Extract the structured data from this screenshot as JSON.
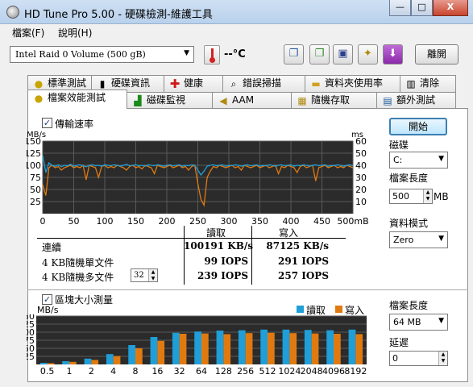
{
  "window": {
    "title": "HD Tune Pro  5.00 - 硬碟檢測-維護工具",
    "controls": {
      "minimize": "—",
      "maximize": "□",
      "close": "X"
    }
  },
  "menu": {
    "file": "檔案(F)",
    "help": "說明(H)"
  },
  "toolbar": {
    "drive": "Intel  Raid 0 Volume (500 gB)",
    "temperature": "--°C",
    "exit_label": "離開",
    "icons": [
      "copy-text-icon",
      "copy-screenshot-icon",
      "save-icon",
      "options-icon",
      "download-icon"
    ]
  },
  "tabs_top": [
    {
      "label": "標準測試",
      "icon": "benchmark-icon"
    },
    {
      "label": "硬碟資訊",
      "icon": "info-icon"
    },
    {
      "label": "健康",
      "icon": "health-icon"
    },
    {
      "label": "錯誤掃描",
      "icon": "error-scan-icon"
    },
    {
      "label": "資料夾使用率",
      "icon": "folder-icon"
    },
    {
      "label": "清除",
      "icon": "erase-icon"
    }
  ],
  "tabs_bottom": [
    {
      "label": "檔案效能測試",
      "icon": "file-benchmark-icon"
    },
    {
      "label": "磁碟監視",
      "icon": "disk-monitor-icon"
    },
    {
      "label": "AAM",
      "icon": "aam-speaker-icon"
    },
    {
      "label": "隨機存取",
      "icon": "random-access-icon"
    },
    {
      "label": "額外測試",
      "icon": "extra-tests-icon"
    }
  ],
  "transfer": {
    "checkbox_label": "傳輸速率",
    "checked": true,
    "left_unit": "MB/s",
    "right_unit": "ms"
  },
  "right_panel": {
    "start": "開始",
    "disk_label": "磁碟",
    "disk_value": "C:",
    "file_length_label": "檔案長度",
    "file_length_value": "500",
    "file_length_unit": "MB",
    "data_mode_label": "資料模式",
    "data_mode_value": "Zero",
    "block_file_length_label": "檔案長度",
    "block_file_length_value": "64 MB",
    "delay_label": "延遲",
    "delay_value": "0"
  },
  "results": {
    "read_header": "讀取",
    "write_header": "寫入",
    "rows": [
      {
        "label": "連續",
        "read": "100191 KB/s",
        "write": "87125 KB/s"
      },
      {
        "label": "4 KB隨機單文件",
        "read": "99 IOPS",
        "write": "291 IOPS"
      },
      {
        "label": "4 KB隨機多文件",
        "read": "239 IOPS",
        "write": "257 IOPS",
        "queue": "32"
      }
    ]
  },
  "block": {
    "checkbox_label": "區塊大小測量",
    "checked": true,
    "unit": "MB/s"
  },
  "colors": {
    "read": "#1f9ed8",
    "write": "#e07a10",
    "chart_bg": "#2b2b2b",
    "grid": "#5a5a5a"
  },
  "chart_data": [
    {
      "type": "line",
      "title": "",
      "xlabel": "",
      "ylabel": "MB/s",
      "y2label": "ms",
      "x_ticks": [
        "0",
        "50",
        "100",
        "150",
        "200",
        "250",
        "300",
        "350",
        "400",
        "450",
        "500mB"
      ],
      "y_ticks": [
        25,
        50,
        75,
        100,
        125,
        150
      ],
      "y2_ticks": [
        10,
        20,
        30,
        40,
        50,
        60
      ],
      "xlim": [
        0,
        500
      ],
      "ylim": [
        0,
        150
      ],
      "y2lim": [
        0,
        60
      ],
      "grid": true,
      "series": [
        {
          "name": "",
          "axis": "ms",
          "color": "#e07a10",
          "x": [
            0,
            5,
            10,
            15,
            20,
            25,
            30,
            35,
            40,
            45,
            50,
            55,
            60,
            65,
            70,
            75,
            80,
            85,
            90,
            95,
            100,
            105,
            110,
            115,
            120,
            125,
            130,
            135,
            140,
            145,
            150,
            155,
            160,
            165,
            170,
            175,
            180,
            185,
            190,
            195,
            200,
            205,
            210,
            215,
            220,
            225,
            230,
            235,
            240,
            245,
            250,
            255,
            260,
            265,
            270,
            275,
            280,
            285,
            290,
            295,
            300,
            305,
            310,
            315,
            320,
            325,
            330,
            335,
            340,
            345,
            350,
            355,
            360,
            365,
            370,
            375,
            380,
            385,
            390,
            395,
            400,
            405,
            410,
            415,
            420,
            425,
            430,
            435,
            440,
            445,
            450,
            455,
            460,
            465,
            470,
            475,
            480,
            485,
            490,
            495,
            500
          ],
          "y": [
            24,
            15,
            38,
            40,
            38,
            39,
            36,
            38,
            39,
            40,
            38,
            39,
            38,
            40,
            28,
            40,
            39,
            38,
            30,
            39,
            40,
            38,
            39,
            38,
            40,
            39,
            38,
            36,
            39,
            40,
            38,
            39,
            37,
            40,
            39,
            38,
            33,
            40,
            39,
            38,
            39,
            40,
            38,
            39,
            40,
            38,
            39,
            36,
            39,
            40,
            25,
            12,
            7,
            30,
            35,
            39,
            38,
            40,
            39,
            38,
            39,
            40,
            38,
            39,
            36,
            40,
            39,
            38,
            39,
            40,
            38,
            39,
            40,
            38,
            39,
            40,
            33,
            39,
            38,
            40,
            39,
            38,
            34,
            39,
            40,
            38,
            39,
            40,
            27,
            38,
            39,
            40,
            38,
            39,
            40,
            38,
            39,
            38,
            40,
            39,
            38
          ]
        },
        {
          "name": "",
          "axis": "MB/s",
          "color": "#1f9ed8",
          "x": [
            0,
            5,
            10,
            15,
            20,
            25,
            30,
            35,
            40,
            45,
            50,
            55,
            60,
            65,
            70,
            75,
            80,
            85,
            90,
            95,
            100,
            105,
            110,
            115,
            120,
            125,
            130,
            135,
            140,
            145,
            150,
            155,
            160,
            165,
            170,
            175,
            180,
            185,
            190,
            195,
            200,
            205,
            210,
            215,
            220,
            225,
            230,
            235,
            240,
            245,
            250,
            255,
            260,
            265,
            270,
            275,
            280,
            285,
            290,
            295,
            300,
            305,
            310,
            315,
            320,
            325,
            330,
            335,
            340,
            345,
            350,
            355,
            360,
            365,
            370,
            375,
            380,
            385,
            390,
            395,
            400,
            405,
            410,
            415,
            420,
            425,
            430,
            435,
            440,
            445,
            450,
            455,
            460,
            465,
            470,
            475,
            480,
            485,
            490,
            495,
            500
          ],
          "y": [
            120,
            85,
            105,
            100,
            98,
            101,
            97,
            100,
            99,
            102,
            98,
            100,
            101,
            99,
            97,
            100,
            101,
            99,
            100,
            98,
            101,
            100,
            99,
            101,
            100,
            98,
            100,
            102,
            99,
            100,
            101,
            99,
            100,
            98,
            101,
            100,
            99,
            101,
            100,
            98,
            100,
            101,
            99,
            100,
            101,
            98,
            100,
            99,
            101,
            100,
            90,
            80,
            88,
            98,
            100,
            101,
            99,
            100,
            101,
            98,
            100,
            99,
            101,
            100,
            98,
            100,
            101,
            99,
            100,
            101,
            98,
            100,
            99,
            101,
            100,
            98,
            100,
            101,
            99,
            100,
            101,
            98,
            100,
            99,
            101,
            100,
            98,
            100,
            101,
            99,
            100,
            101,
            98,
            100,
            99,
            101,
            100,
            98,
            100,
            101,
            99
          ]
        }
      ]
    },
    {
      "type": "bar",
      "title": "",
      "xlabel": "",
      "ylabel": "MB/s",
      "categories": [
        "0.5",
        "1",
        "2",
        "4",
        "8",
        "16",
        "32",
        "64",
        "128",
        "256",
        "512",
        "1024",
        "2048",
        "4096",
        "8192"
      ],
      "ylim": [
        0,
        150
      ],
      "y_ticks": [
        25,
        50,
        75,
        100,
        125,
        150
      ],
      "legend": "top-right",
      "grid": true,
      "series": [
        {
          "name": "讀取",
          "color": "#1f9ed8",
          "values": [
            5,
            10,
            18,
            32,
            60,
            85,
            98,
            102,
            105,
            106,
            108,
            108,
            107,
            106,
            108
          ]
        },
        {
          "name": "寫入",
          "color": "#e07a10",
          "values": [
            4,
            8,
            14,
            26,
            50,
            73,
            95,
            96,
            94,
            97,
            98,
            97,
            96,
            95,
            94
          ]
        }
      ]
    }
  ]
}
